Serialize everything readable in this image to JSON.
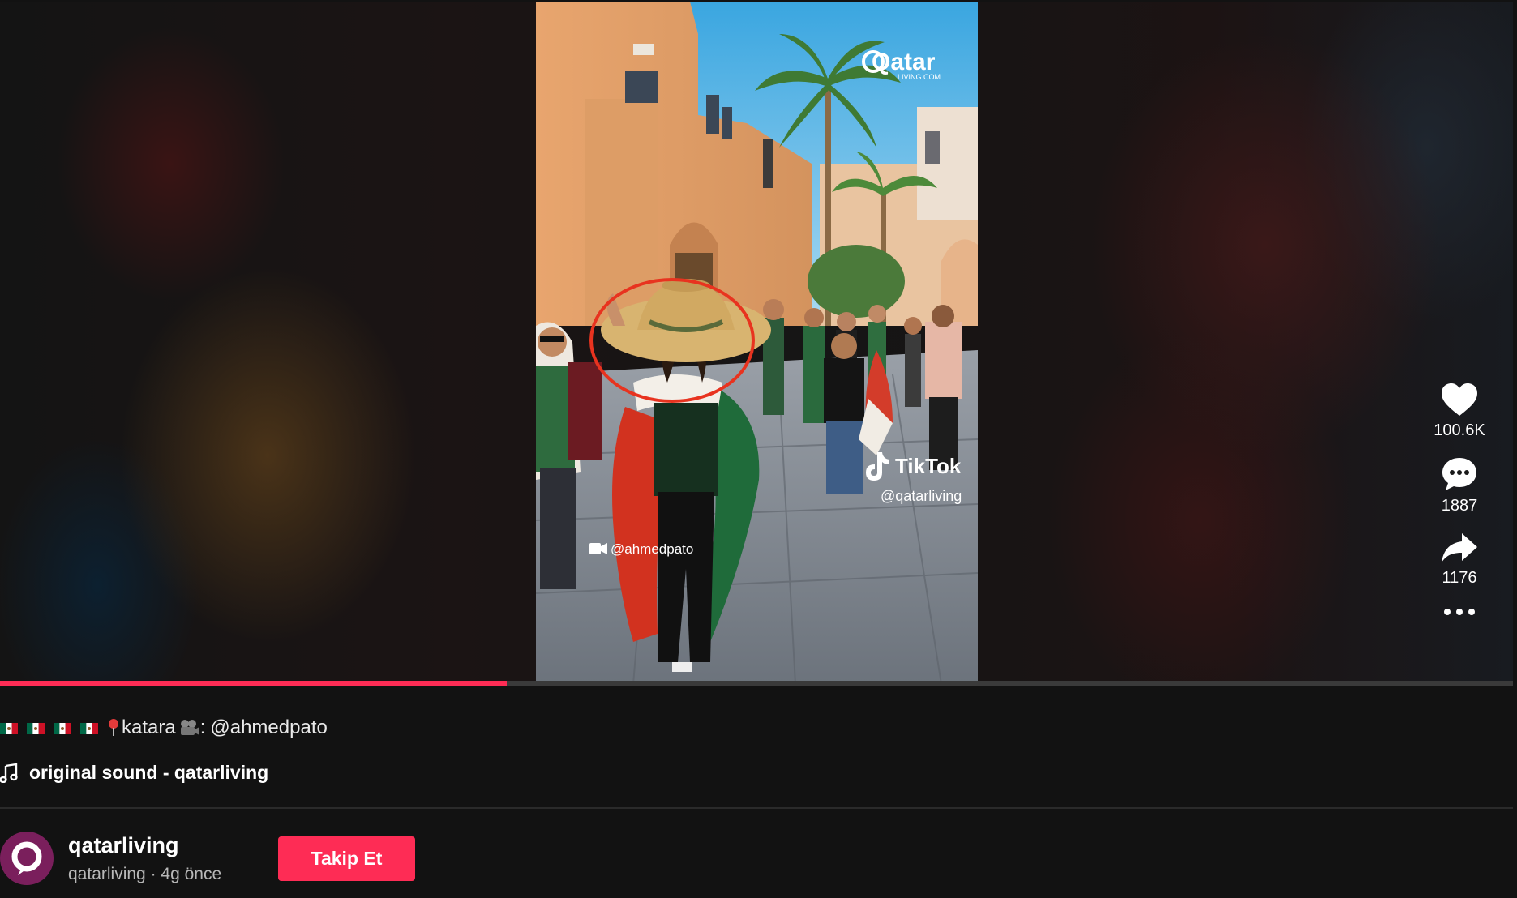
{
  "video": {
    "watermark_brand": "Qatar",
    "watermark_brand_sub": "LIVING.COM",
    "tiktok_logo_text": "TikTok",
    "tiktok_handle": "@qatarliving",
    "camera_credit": "@ahmedpato",
    "progress_fraction": 0.335,
    "accent_color": "#fe2c55"
  },
  "actions": {
    "likes": "100.6K",
    "comments": "1887",
    "shares": "1176"
  },
  "caption": {
    "flag_count": 4,
    "place": "katara",
    "separator": ":",
    "mention": "@ahmedpato"
  },
  "sound": {
    "label": "original sound - qatarliving"
  },
  "author": {
    "username": "qatarliving",
    "handle": "qatarliving",
    "separator": " · ",
    "posted": "4g önce"
  },
  "follow_button": {
    "label": "Takip Et"
  }
}
